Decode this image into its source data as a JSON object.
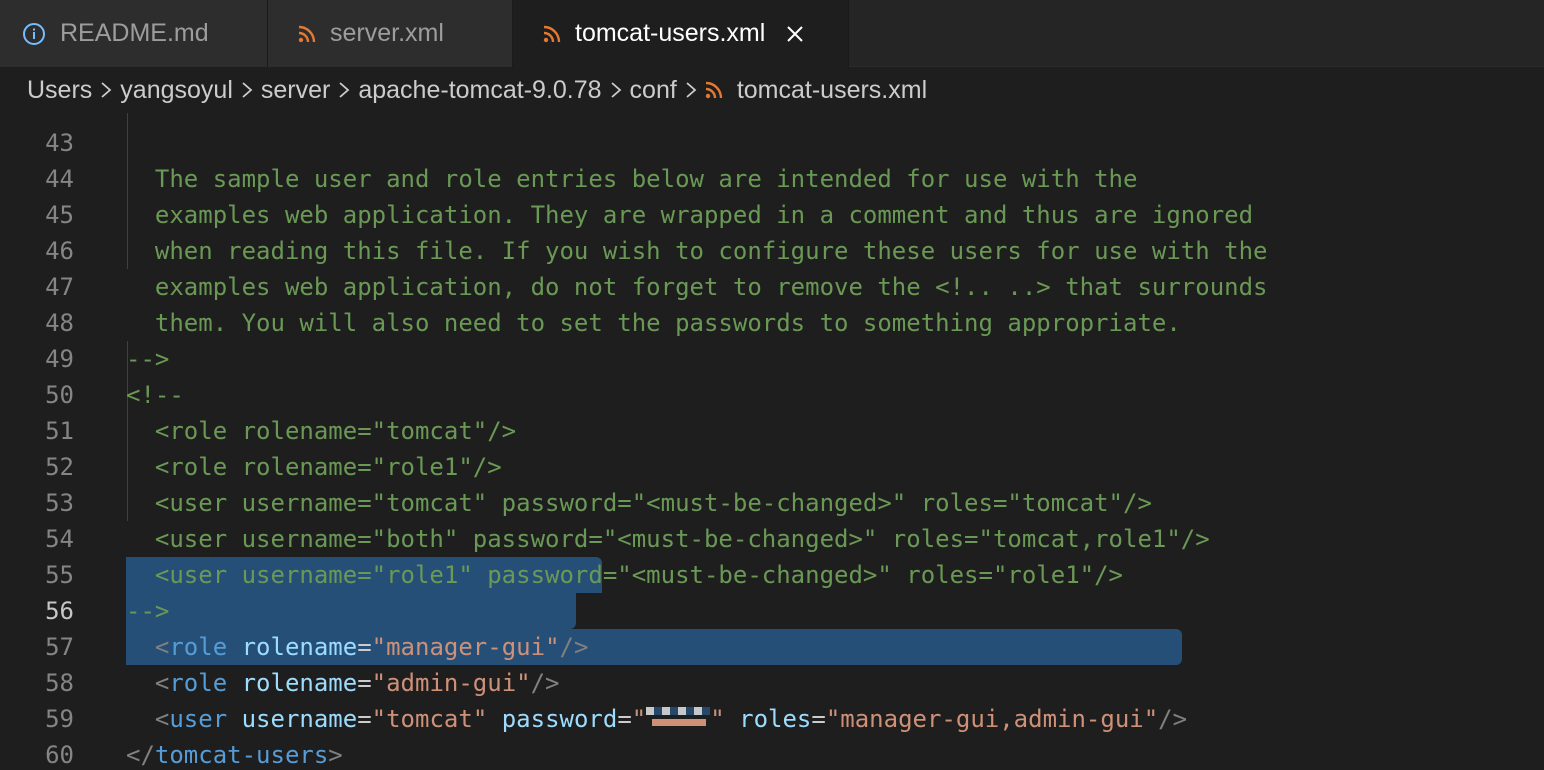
{
  "tabs": [
    {
      "label": "README.md",
      "icon": "info-icon",
      "active": false
    },
    {
      "label": "server.xml",
      "icon": "rss-icon",
      "active": false
    },
    {
      "label": "tomcat-users.xml",
      "icon": "rss-icon",
      "active": true
    }
  ],
  "breadcrumb": [
    "Users",
    "yangsoyul",
    "server",
    "apache-tomcat-9.0.78",
    "conf",
    "tomcat-users.xml"
  ],
  "colors": {
    "rss_icon": "#e37933",
    "info_icon": "#75beff",
    "selection": "#264f78",
    "comment": "#6a9955",
    "tag": "#569cd6",
    "attr": "#9cdcfe",
    "string": "#ce9178"
  },
  "editor": {
    "current_line": "56",
    "lines": [
      {
        "n": "43",
        "text": "  The sample user and role entries below are intended for use with the"
      },
      {
        "n": "44",
        "text": "  examples web application. They are wrapped in a comment and thus are ignored"
      },
      {
        "n": "45",
        "text": "  when reading this file. If you wish to configure these users for use with the"
      },
      {
        "n": "46",
        "text": "  examples web application, do not forget to remove the <!.. ..> that surrounds"
      },
      {
        "n": "47",
        "text": "  them. You will also need to set the passwords to something appropriate."
      },
      {
        "n": "48",
        "text": "-->"
      },
      {
        "n": "49",
        "text": "<!--"
      },
      {
        "n": "50",
        "text": "  <role rolename=\"tomcat\"/>"
      },
      {
        "n": "51",
        "text": "  <role rolename=\"role1\"/>"
      },
      {
        "n": "52",
        "text": "  <user username=\"tomcat\" password=\"<must-be-changed>\" roles=\"tomcat\"/>"
      },
      {
        "n": "53",
        "text": "  <user username=\"both\" password=\"<must-be-changed>\" roles=\"tomcat,role1\"/>"
      },
      {
        "n": "54",
        "text": "  <user username=\"role1\" password=\"<must-be-changed>\" roles=\"role1\"/>"
      },
      {
        "n": "55",
        "text": "-->"
      },
      {
        "n": "56",
        "tag": "role",
        "attr1": "rolename",
        "val1": "manager-gui"
      },
      {
        "n": "57",
        "tag": "role",
        "attr1": "rolename",
        "val1": "admin-gui"
      },
      {
        "n": "58",
        "tag": "user",
        "attr1": "username",
        "val1": "tomcat",
        "attr2": "password",
        "attr3": "roles",
        "val3": "manager-gui,admin-gui"
      },
      {
        "n": "59",
        "close_tag": "tomcat-users"
      },
      {
        "n": "60",
        "text": ""
      }
    ]
  }
}
